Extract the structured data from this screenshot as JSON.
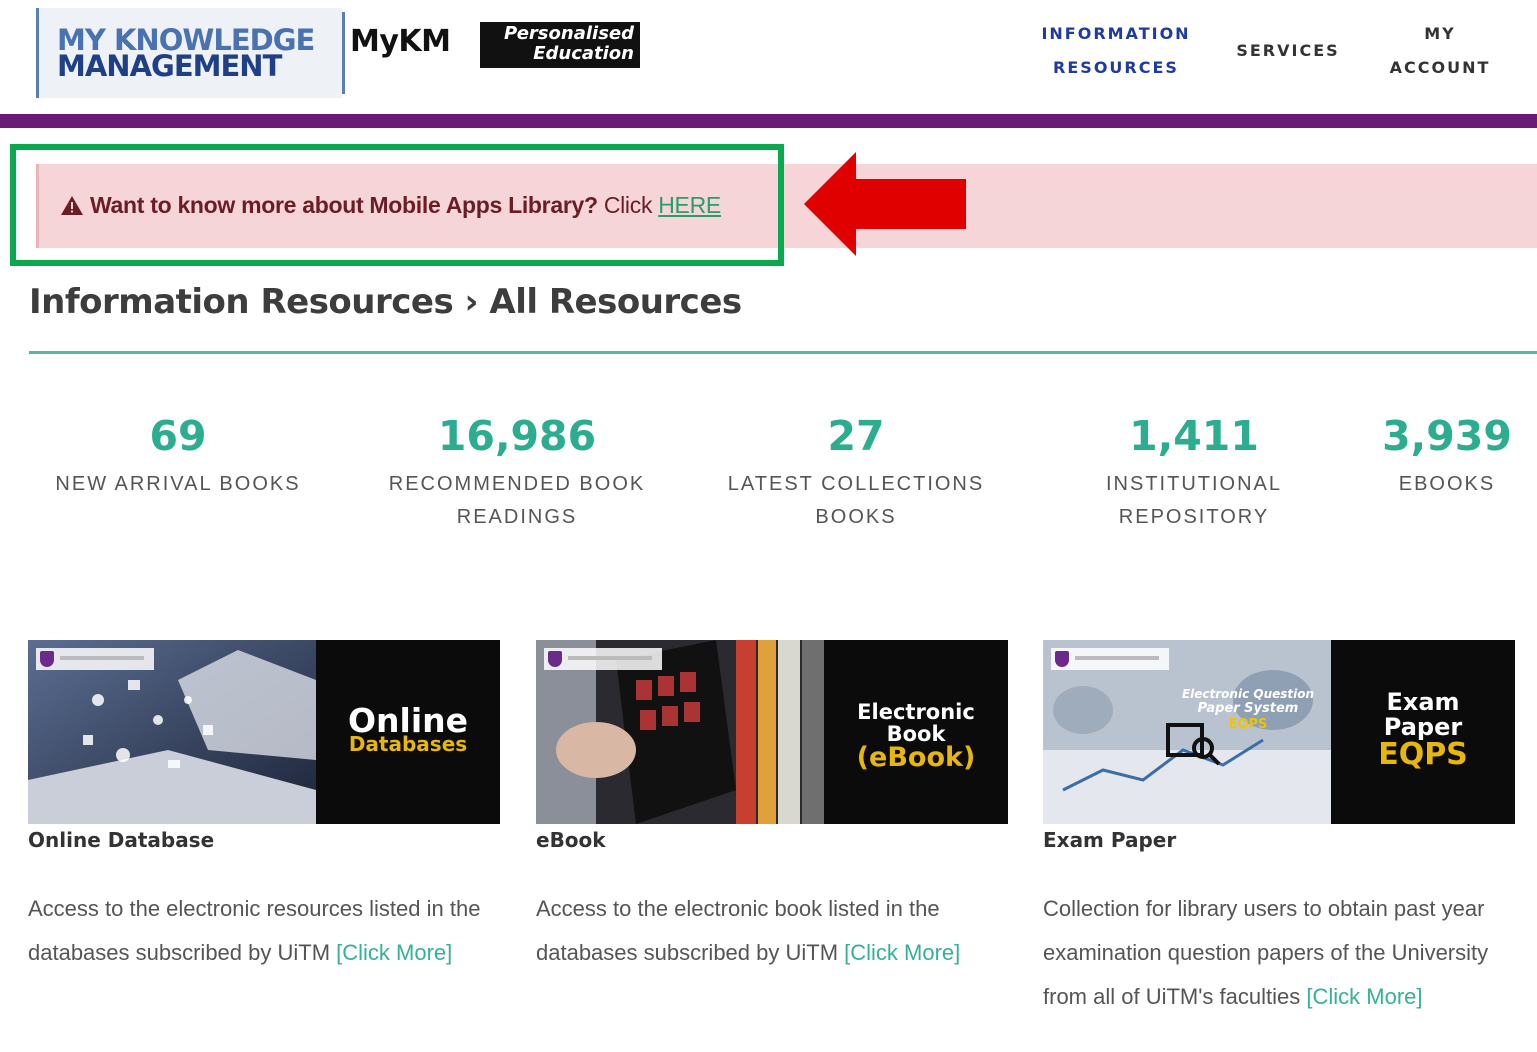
{
  "header": {
    "logo_line1": "MY KNOWLEDGE",
    "logo_line2": "MANAGEMENT",
    "logo_mykm": "MyKM",
    "logo_pe_line1": "Personalised",
    "logo_pe_line2": "Education",
    "nav": {
      "info_line1": "INFORMATION",
      "info_line2": "RESOURCES",
      "services": "SERVICES",
      "account_line1": "MY",
      "account_line2": "ACCOUNT"
    }
  },
  "alert": {
    "text": "Want to know more about Mobile Apps Library?",
    "click": "Click",
    "link": "HERE"
  },
  "page_title": "Information Resources › All Resources",
  "stats": [
    {
      "value": "69",
      "label_line1": "NEW ARRIVAL BOOKS",
      "label_line2": ""
    },
    {
      "value": "16,986",
      "label_line1": "RECOMMENDED BOOK",
      "label_line2": "READINGS"
    },
    {
      "value": "27",
      "label_line1": "LATEST COLLECTIONS",
      "label_line2": "BOOKS"
    },
    {
      "value": "1,411",
      "label_line1": "INSTITUTIONAL",
      "label_line2": "REPOSITORY"
    },
    {
      "value": "3,939",
      "label_line1": "EBOOKS",
      "label_line2": ""
    }
  ],
  "cards": [
    {
      "banner_line1": "Online",
      "banner_line2": "Databases",
      "title": "Online Database",
      "desc": "Access to the electronic resources listed in the databases subscribed by UiTM ",
      "more": "[Click More]"
    },
    {
      "banner_line1": "Electronic",
      "banner_line2": "Book",
      "banner_line3": "(eBook)",
      "title": "eBook",
      "desc": "Access to the electronic book listed in the databases subscribed by UiTM ",
      "more": "[Click More]"
    },
    {
      "banner_line1": "Exam",
      "banner_line2": "Paper",
      "banner_line3": "EQPS",
      "photo_caption_1": "Electronic Question",
      "photo_caption_2": "Paper System",
      "photo_caption_3": "EQPS",
      "title": "Exam Paper",
      "desc": "Collection for library users to obtain past year examination question papers of the University from all of UiTM's faculties ",
      "more": "[Click More]"
    }
  ],
  "colors": {
    "purple_bar": "#6a1b78",
    "accent_teal": "#2dad90",
    "alert_bg": "#f5d5d8",
    "highlight_box": "#0aa84f",
    "arrow": "#e00000"
  }
}
